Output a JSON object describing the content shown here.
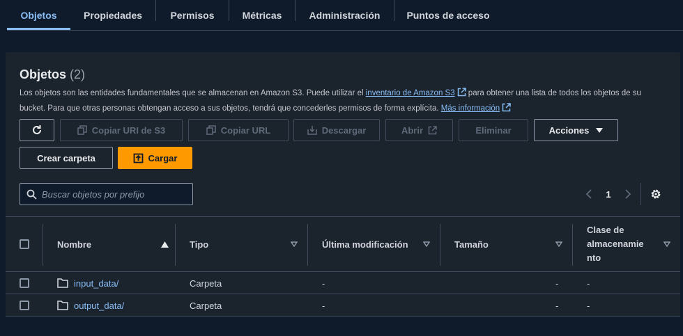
{
  "tabs": [
    {
      "label": "Objetos",
      "active": true
    },
    {
      "label": "Propiedades"
    },
    {
      "label": "Permisos"
    },
    {
      "label": "Métricas"
    },
    {
      "label": "Administración"
    },
    {
      "label": "Puntos de acceso"
    }
  ],
  "panel": {
    "title": "Objetos",
    "count": "(2)",
    "desc_part1": "Los objetos son las entidades fundamentales que se almacenan en Amazon S3. Puede utilizar el ",
    "desc_link1": "inventario de Amazon S3",
    "desc_part2": " para obtener una lista de todos los objetos de su bucket. Para que otras personas obtengan acceso a sus objetos, tendrá que concederles permisos de forma explícita. ",
    "desc_link2": "Más información"
  },
  "toolbar": {
    "copy_uri": "Copiar URI de S3",
    "copy_url": "Copiar URL",
    "download": "Descargar",
    "open": "Abrir",
    "delete": "Eliminar",
    "actions": "Acciones",
    "create_folder": "Crear carpeta",
    "upload": "Cargar"
  },
  "search": {
    "placeholder": "Buscar objetos por prefijo"
  },
  "pagination": {
    "current_page": "1"
  },
  "table": {
    "columns": {
      "name": "Nombre",
      "type": "Tipo",
      "modified": "Última modificación",
      "size": "Tamaño",
      "storage_class_1": "Clase de",
      "storage_class_2": "almacenamie",
      "storage_class_3": "nto"
    },
    "rows": [
      {
        "name": "input_data/",
        "type": "Carpeta",
        "modified": "-",
        "size": "-",
        "storage": "-"
      },
      {
        "name": "output_data/",
        "type": "Carpeta",
        "modified": "-",
        "size": "-",
        "storage": "-"
      }
    ]
  },
  "colors": {
    "accent": "#89bdf5",
    "primary": "#ff9900",
    "background": "#0f1b2a",
    "panel": "#1b232d"
  }
}
